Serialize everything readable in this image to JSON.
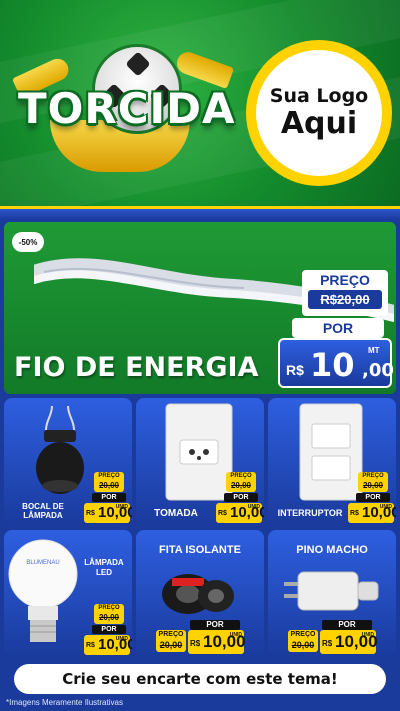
{
  "header": {
    "banner_title": "TORCIDA",
    "logo_line1": "Sua Logo",
    "logo_line2": "Aqui"
  },
  "featured": {
    "discount": "-50%",
    "name": "FIO DE ENERGIA",
    "preco_label": "PREÇO",
    "old_price": "R$20,00",
    "por_label": "POR",
    "currency": "R$",
    "price_int": "10",
    "price_cents": ",00",
    "unit": "MT"
  },
  "products": [
    {
      "name": "BOCAL DE LÂMPADA",
      "preco_label": "PREÇO",
      "old_price": "20,00",
      "por_label": "POR",
      "currency": "R$",
      "price": "10,00",
      "unit": "UNID"
    },
    {
      "name": "TOMADA",
      "preco_label": "PREÇO",
      "old_price": "20,00",
      "por_label": "POR",
      "currency": "R$",
      "price": "10,00",
      "unit": "UNID"
    },
    {
      "name": "INTERRUPTOR",
      "preco_label": "PREÇO",
      "old_price": "20,00",
      "por_label": "POR",
      "currency": "R$",
      "price": "10,00",
      "unit": "UNID"
    },
    {
      "name": "LÂMPADA LED",
      "preco_label": "PREÇO",
      "old_price": "20,00",
      "por_label": "POR",
      "currency": "R$",
      "price": "10,00",
      "unit": "UNID"
    },
    {
      "name": "FITA ISOLANTE",
      "preco_label": "PREÇO",
      "old_price": "20,00",
      "por_label": "POR",
      "currency": "R$",
      "price": "10,00",
      "unit": "UNID"
    },
    {
      "name": "PINO MACHO",
      "preco_label": "PREÇO",
      "old_price": "20,00",
      "por_label": "POR",
      "currency": "R$",
      "price": "10,00",
      "unit": "UNID"
    }
  ],
  "cta": "Crie seu encarte com este tema!",
  "footnote": "*Imagens Meramente Ilustrativas",
  "colors": {
    "green": "#138a2c",
    "blue": "#1a3a9c",
    "yellow": "#ffd200"
  }
}
